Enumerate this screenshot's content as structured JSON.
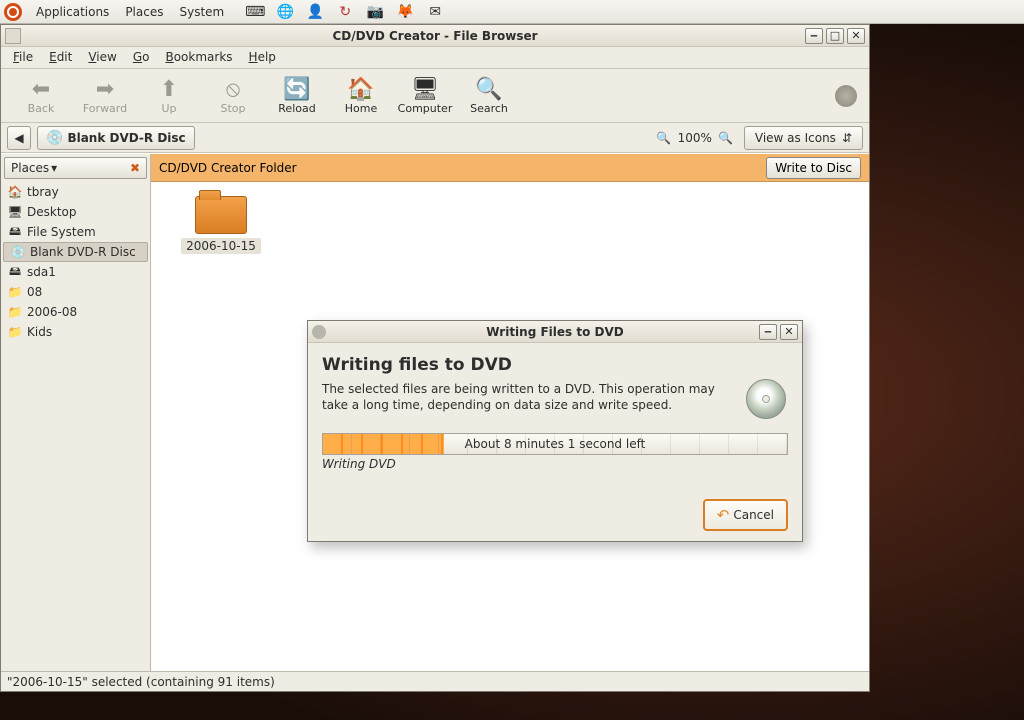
{
  "panel": {
    "menus": [
      "Applications",
      "Places",
      "System"
    ],
    "icons": [
      "terminal-icon",
      "web-icon",
      "person-icon",
      "update-icon",
      "camera-icon",
      "gimp-icon",
      "mail-icon"
    ]
  },
  "window": {
    "title": "CD/DVD Creator - File Browser",
    "menus": [
      "File",
      "Edit",
      "View",
      "Go",
      "Bookmarks",
      "Help"
    ],
    "toolbar": [
      {
        "name": "back",
        "label": "Back",
        "enabled": false
      },
      {
        "name": "forward",
        "label": "Forward",
        "enabled": false
      },
      {
        "name": "up",
        "label": "Up",
        "enabled": false
      },
      {
        "name": "stop",
        "label": "Stop",
        "enabled": false
      },
      {
        "name": "reload",
        "label": "Reload",
        "enabled": true
      },
      {
        "name": "home",
        "label": "Home",
        "enabled": true
      },
      {
        "name": "computer",
        "label": "Computer",
        "enabled": true
      },
      {
        "name": "search",
        "label": "Search",
        "enabled": true
      }
    ],
    "location_crumb": "Blank DVD-R Disc",
    "zoom_text": "100%",
    "view_mode": "View as Icons",
    "sidebar_title": "Places",
    "places": [
      {
        "label": "tbray",
        "icon": "🏠"
      },
      {
        "label": "Desktop",
        "icon": "🖥"
      },
      {
        "label": "File System",
        "icon": "🖴"
      },
      {
        "label": "Blank DVD-R Disc",
        "icon": "💿",
        "selected": true
      },
      {
        "label": "sda1",
        "icon": "🖴"
      },
      {
        "label": "08",
        "icon": "📁"
      },
      {
        "label": "2006-08",
        "icon": "📁"
      },
      {
        "label": "Kids",
        "icon": "📁"
      }
    ],
    "content_header": "CD/DVD Creator Folder",
    "write_button": "Write to Disc",
    "file_item": "2006-10-15",
    "statusbar": "\"2006-10-15\" selected (containing 91 items)"
  },
  "dialog": {
    "title": "Writing Files to DVD",
    "heading": "Writing files to DVD",
    "body": "The selected files are being written to a DVD.  This operation may take a long time, depending on data size and write speed.",
    "progress_text": "About 8 minutes 1 second left",
    "progress_sub": "Writing DVD",
    "progress_percent": 26,
    "cancel_label": "Cancel"
  }
}
